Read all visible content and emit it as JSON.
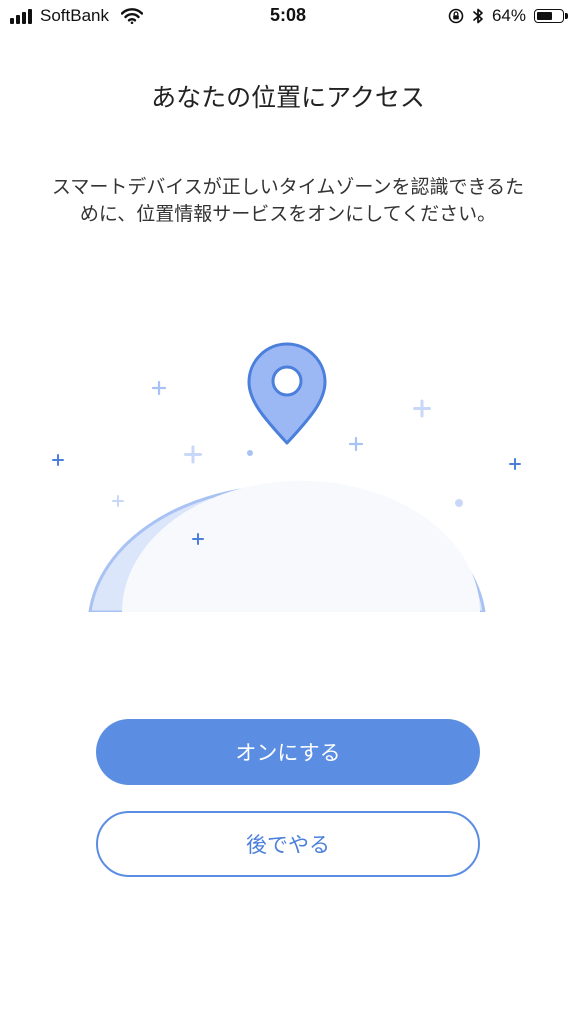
{
  "status_bar": {
    "carrier": "SoftBank",
    "time": "5:08",
    "battery_percent": "64%",
    "battery_level": 0.64,
    "icons": [
      "signal-icon",
      "wifi-icon",
      "orientation-lock-icon",
      "bluetooth-icon",
      "battery-icon"
    ]
  },
  "main": {
    "title": "あなたの位置にアクセス",
    "description": "スマートデバイスが正しいタイムゾーンを認識できるために、位置情報サービスをオンにしてください。",
    "illustration_icons": [
      "location-pin-icon",
      "globe-illustration",
      "sparkle-icon"
    ]
  },
  "actions": {
    "primary_label": "オンにする",
    "secondary_label": "後でやる"
  },
  "colors": {
    "accent": "#5b8ee3",
    "accent_text": "#4a7fdc",
    "pin_fill": "#9bb8f5",
    "globe_fill": "#f7f9fd",
    "globe_shade": "#dbe6fb"
  }
}
